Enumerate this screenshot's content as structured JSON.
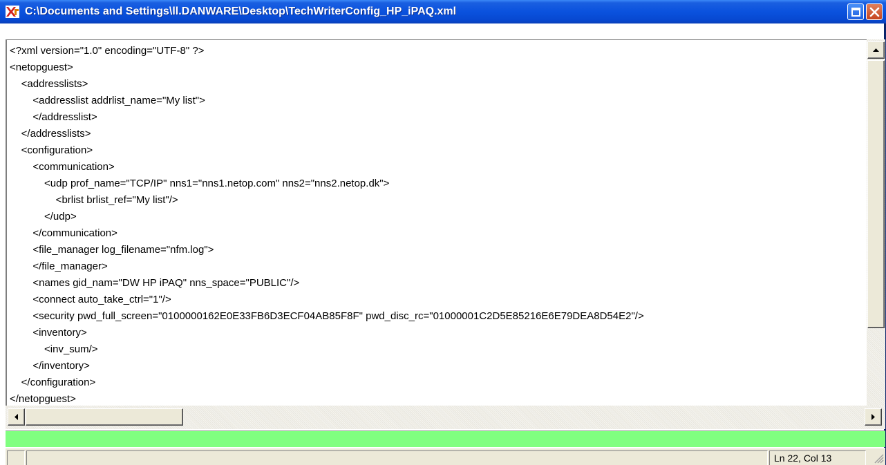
{
  "window": {
    "title": "C:\\Documents and Settings\\ll.DANWARE\\Desktop\\TechWriterConfig_HP_iPAQ.xml",
    "icon": "netop-app-icon",
    "buttons": [
      "maximize-icon",
      "close-icon"
    ]
  },
  "editor": {
    "lines": [
      "<?xml version=\"1.0\" encoding=\"UTF-8\" ?>",
      "<netopguest>",
      "    <addresslists>",
      "        <addresslist addrlist_name=\"My list\">",
      "        </addresslist>",
      "    </addresslists>",
      "    <configuration>",
      "        <communication>",
      "            <udp prof_name=\"TCP/IP\" nns1=\"nns1.netop.com\" nns2=\"nns2.netop.dk\">",
      "                <brlist brlist_ref=\"My list\"/>",
      "            </udp>",
      "        </communication>",
      "        <file_manager log_filename=\"nfm.log\">",
      "        </file_manager>",
      "        <names gid_nam=\"DW HP iPAQ\" nns_space=\"PUBLIC\"/>",
      "        <connect auto_take_ctrl=\"1\"/>",
      "        <security pwd_full_screen=\"0100000162E0E33FB6D3ECF04AB85F8F\" pwd_disc_rc=\"01000001C2D5E85216E6E79DEA8D54E2\"/>",
      "        <inventory>",
      "            <inv_sum/>",
      "        </inventory>",
      "    </configuration>",
      "</netopguest>"
    ]
  },
  "progress": {
    "color": "#80ff80"
  },
  "status": {
    "position": "Ln 22, Col 13"
  },
  "colors": {
    "titlebar": "#0a52de",
    "close": "#c6451f"
  }
}
